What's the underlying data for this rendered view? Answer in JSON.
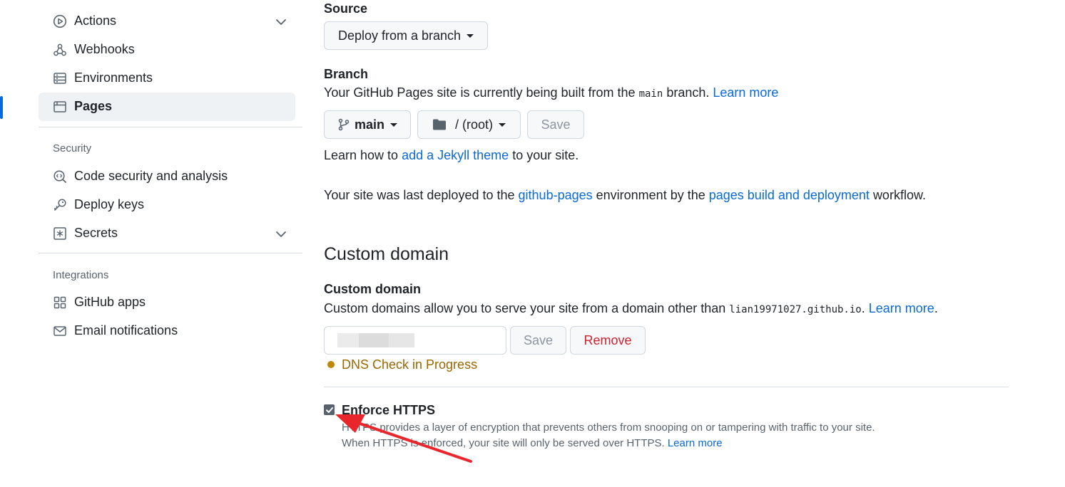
{
  "sidebar": {
    "items_top": [
      {
        "label": "Actions",
        "icon": "play-circle-icon",
        "expandable": true
      },
      {
        "label": "Webhooks",
        "icon": "webhook-icon",
        "expandable": false
      },
      {
        "label": "Environments",
        "icon": "server-icon",
        "expandable": false
      },
      {
        "label": "Pages",
        "icon": "browser-icon",
        "expandable": false,
        "active": true
      }
    ],
    "security_label": "Security",
    "security_items": [
      {
        "label": "Code security and analysis",
        "icon": "codescan-icon"
      },
      {
        "label": "Deploy keys",
        "icon": "key-icon"
      },
      {
        "label": "Secrets",
        "icon": "asterisk-icon",
        "expandable": true
      }
    ],
    "integrations_label": "Integrations",
    "integration_items": [
      {
        "label": "GitHub apps",
        "icon": "apps-icon"
      },
      {
        "label": "Email notifications",
        "icon": "mail-icon"
      }
    ]
  },
  "source": {
    "label": "Source",
    "dropdown": "Deploy from a branch"
  },
  "branch": {
    "label": "Branch",
    "desc_prefix": "Your GitHub Pages site is currently being built from the",
    "branch_code": "main",
    "desc_suffix": "branch.",
    "learn_more": "Learn more",
    "branch_button": "main",
    "folder_button": "/ (root)",
    "save": "Save"
  },
  "jekyll": {
    "prefix": "Learn how to",
    "link": "add a Jekyll theme",
    "suffix": "to your site."
  },
  "deployment": {
    "prefix": "Your site was last deployed to the",
    "env_link": "github-pages",
    "middle": "environment by the",
    "workflow_link": "pages build and deployment",
    "suffix": "workflow."
  },
  "custom_domain": {
    "heading": "Custom domain",
    "label": "Custom domain",
    "desc_prefix": "Custom domains allow you to serve your site from a domain other than",
    "domain_code": "lian19971027.github.io",
    "learn_more": "Learn more",
    "save": "Save",
    "remove": "Remove",
    "status": "DNS Check in Progress",
    "status_color": "#bf8700"
  },
  "https": {
    "label": "Enforce HTTPS",
    "checked": true,
    "line1": "HTTPS provides a layer of encryption that prevents others from snooping on or tampering with traffic to your site.",
    "line2_prefix": "When HTTPS is enforced, your site will only be served over HTTPS.",
    "learn_more": "Learn more"
  },
  "colors": {
    "link": "#0969da",
    "active_bar": "#0969da",
    "danger": "#cf222e",
    "annotation_arrow": "#e8262b"
  }
}
